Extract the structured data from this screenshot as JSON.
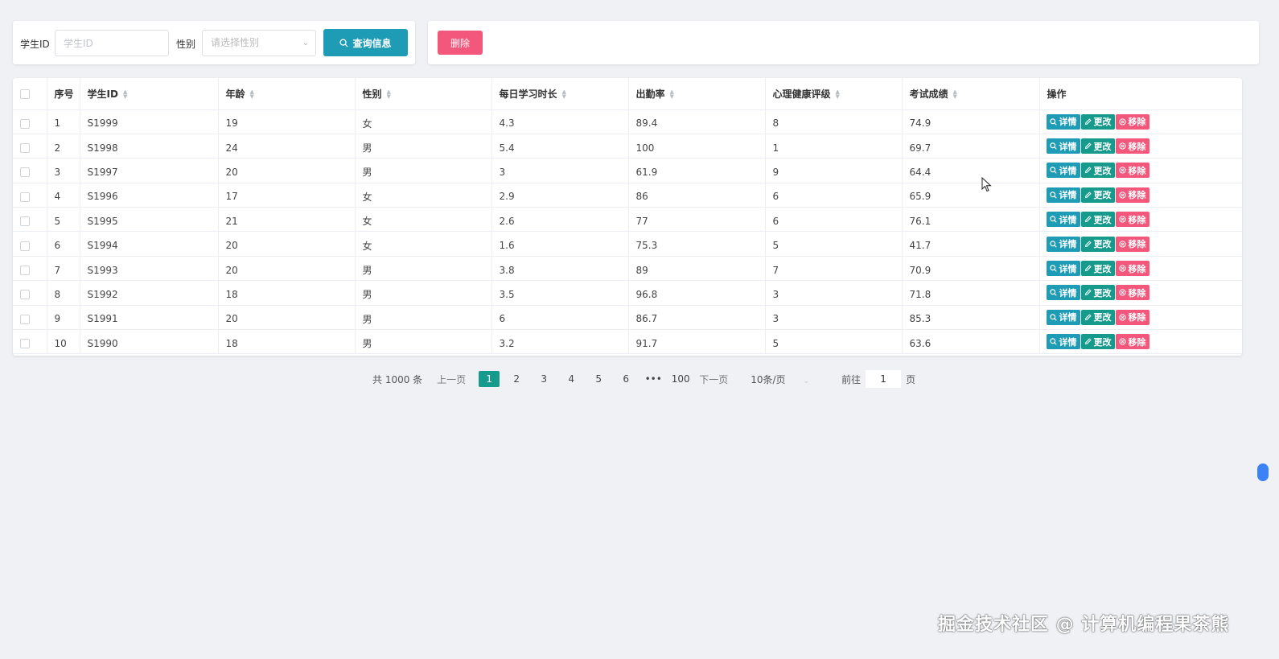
{
  "search": {
    "id_label": "学生ID",
    "id_placeholder": "学生ID",
    "gender_label": "性别",
    "gender_placeholder": "请选择性别",
    "search_button": "查询信息"
  },
  "actions": {
    "delete_button": "删除"
  },
  "table": {
    "headers": {
      "index": "序号",
      "student_id": "学生ID",
      "age": "年龄",
      "gender": "性别",
      "study_hours": "每日学习时长",
      "attendance": "出勤率",
      "mental_health": "心理健康评级",
      "exam_score": "考试成绩",
      "operations": "操作"
    },
    "buttons": {
      "detail": "详情",
      "edit": "更改",
      "remove": "移除"
    },
    "rows": [
      {
        "no": "1",
        "id": "S1999",
        "age": "19",
        "gender": "女",
        "hours": "4.3",
        "attendance": "89.4",
        "mental": "8",
        "score": "74.9"
      },
      {
        "no": "2",
        "id": "S1998",
        "age": "24",
        "gender": "男",
        "hours": "5.4",
        "attendance": "100",
        "mental": "1",
        "score": "69.7"
      },
      {
        "no": "3",
        "id": "S1997",
        "age": "20",
        "gender": "男",
        "hours": "3",
        "attendance": "61.9",
        "mental": "9",
        "score": "64.4"
      },
      {
        "no": "4",
        "id": "S1996",
        "age": "17",
        "gender": "女",
        "hours": "2.9",
        "attendance": "86",
        "mental": "6",
        "score": "65.9"
      },
      {
        "no": "5",
        "id": "S1995",
        "age": "21",
        "gender": "女",
        "hours": "2.6",
        "attendance": "77",
        "mental": "6",
        "score": "76.1"
      },
      {
        "no": "6",
        "id": "S1994",
        "age": "20",
        "gender": "女",
        "hours": "1.6",
        "attendance": "75.3",
        "mental": "5",
        "score": "41.7"
      },
      {
        "no": "7",
        "id": "S1993",
        "age": "20",
        "gender": "男",
        "hours": "3.8",
        "attendance": "89",
        "mental": "7",
        "score": "70.9"
      },
      {
        "no": "8",
        "id": "S1992",
        "age": "18",
        "gender": "男",
        "hours": "3.5",
        "attendance": "96.8",
        "mental": "3",
        "score": "71.8"
      },
      {
        "no": "9",
        "id": "S1991",
        "age": "20",
        "gender": "男",
        "hours": "6",
        "attendance": "86.7",
        "mental": "3",
        "score": "85.3"
      },
      {
        "no": "10",
        "id": "S1990",
        "age": "18",
        "gender": "男",
        "hours": "3.2",
        "attendance": "91.7",
        "mental": "5",
        "score": "63.6"
      }
    ]
  },
  "pagination": {
    "total": "共 1000 条",
    "prev": "上一页",
    "pages": [
      "1",
      "2",
      "3",
      "4",
      "5",
      "6"
    ],
    "ellipsis": "•••",
    "last_page": "100",
    "next": "下一页",
    "page_size": "10条/页",
    "goto_label": "前往",
    "goto_value": "1",
    "goto_suffix": "页"
  },
  "watermark": "掘金技术社区 @ 计算机编程果茶熊",
  "colors": {
    "primary": "#1e9bb5",
    "success": "#169a8c",
    "danger": "#f4577c",
    "background": "#eff1f5"
  }
}
